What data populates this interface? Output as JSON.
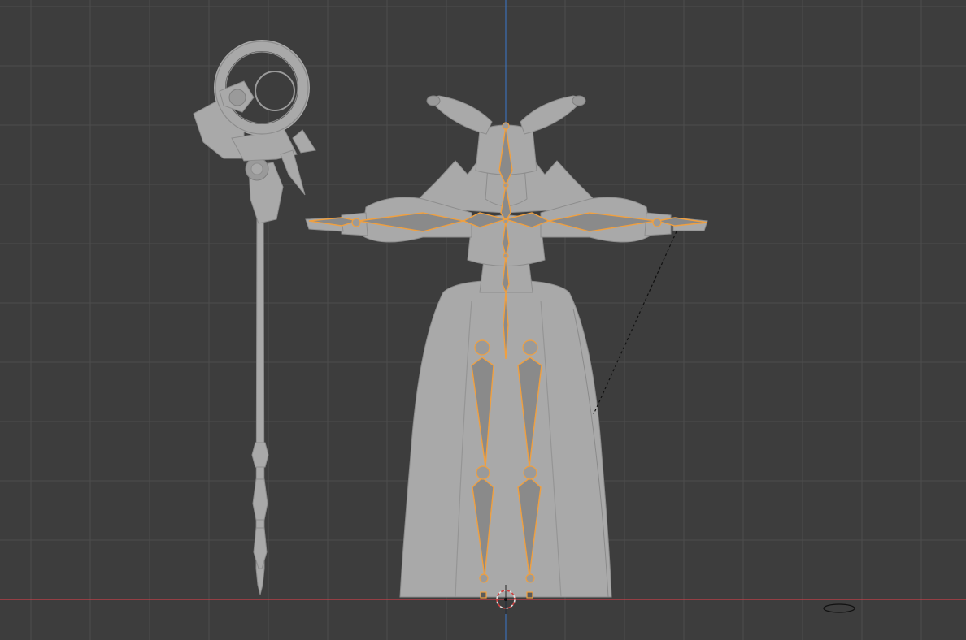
{
  "viewport": {
    "mode": "front-orthographic-pose-view",
    "background": "#3d3d3d",
    "grid_minor": "#454545",
    "grid_major": "#4d4d4d",
    "x_axis_color": "#c8404a",
    "z_axis_color": "#3b6fb5",
    "selection_color": "#f0a040",
    "mesh_color": "#a9a9a9"
  },
  "objects": {
    "staff": "staff-mesh",
    "character": "character-mesh",
    "armature": "armature-selected",
    "light": "light-object"
  }
}
